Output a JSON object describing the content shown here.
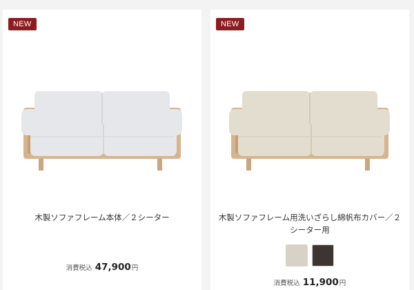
{
  "products": [
    {
      "badge": "NEW",
      "name": "木製ソファフレーム本体／２シーター",
      "tax_label": "消費税込",
      "price": "47,900",
      "currency": "円",
      "fabric_color": "#e6e7eb",
      "fabric_shade": "#cfd1d6"
    },
    {
      "badge": "NEW",
      "name": "木製ソファフレーム用洗いざらし綿帆布カバー／２シーター用",
      "tax_label": "消費税込",
      "price": "11,900",
      "currency": "円",
      "fabric_color": "#e3ddd0",
      "fabric_shade": "#cbc4b5",
      "swatches": [
        {
          "color": "#d8d1c5"
        },
        {
          "color": "#3d3531"
        }
      ]
    }
  ],
  "colors": {
    "badge_bg": "#8c1c20",
    "frame_wood": "#d7b48c",
    "page_bg": "#f3f3f3"
  }
}
